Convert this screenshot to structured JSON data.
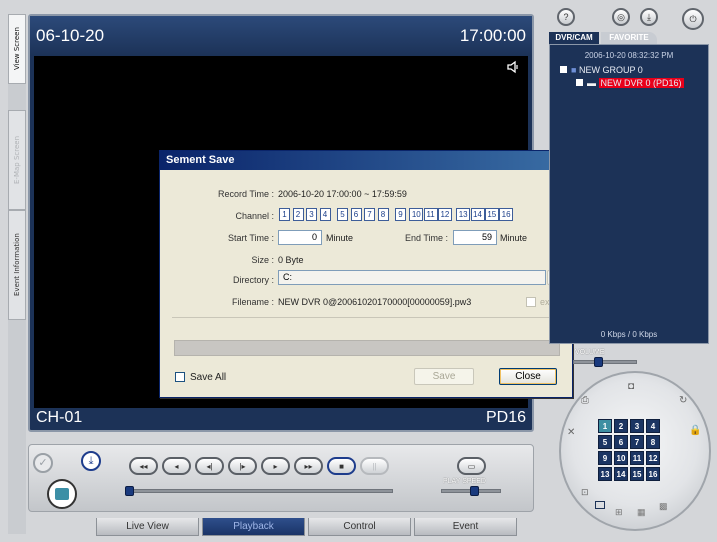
{
  "side_tabs": {
    "view_screen": "View Screen",
    "e_map_screen": "E-Map Screen",
    "event_information": "Event Information"
  },
  "video": {
    "date": "06-10-20",
    "time": "17:00:00",
    "channel": "CH-01",
    "device": "PD16"
  },
  "dialog": {
    "title": "Sement Save",
    "record_time_label": "Record Time :",
    "record_time_value": "2006-10-20  17:00:00 ~ 17:59:59",
    "channel_label": "Channel :",
    "channels": [
      "1",
      "2",
      "3",
      "4",
      "5",
      "6",
      "7",
      "8",
      "9",
      "10",
      "11",
      "12",
      "13",
      "14",
      "15",
      "16"
    ],
    "start_time_label": "Start Time :",
    "start_time_value": "0",
    "minute_label": "Minute",
    "end_time_label": "End Time :",
    "end_time_value": "59",
    "size_label": "Size :",
    "size_value": "0 Byte",
    "directory_label": "Directory :",
    "directory_value": "C:",
    "browse_label": "...",
    "filename_label": "Filename :",
    "filename_value": "NEW DVR 0@20061020170000[00000059].pw3",
    "exe_label": "exe",
    "save_all_label": "Save All",
    "save_button": "Save",
    "close_button": "Close"
  },
  "playback": {
    "play_speed_label": "PLAY SPEED"
  },
  "bottom_tabs": [
    "Live View",
    "Playback",
    "Control",
    "Event"
  ],
  "right_panel": {
    "tabs": [
      "DVR/CAM",
      "FAVORITE"
    ],
    "timestamp": "2006-10-20 08:32:32 PM",
    "group": "NEW GROUP 0",
    "dvr": "NEW DVR 0 (PD16)",
    "bandwidth": "0 Kbps / 0 Kbps",
    "volume_label": "VOLUME",
    "ptz_numbers": [
      "1",
      "2",
      "3",
      "4",
      "5",
      "6",
      "7",
      "8",
      "9",
      "10",
      "11",
      "12",
      "13",
      "14",
      "15",
      "16"
    ]
  },
  "top_icons": [
    "help-icon",
    "settings-icon",
    "download-icon",
    "power-icon"
  ],
  "colors": {
    "panel_blue": "#1c3257",
    "dialog_title": "#0a246a",
    "selected_dvr": "#e8001a"
  }
}
